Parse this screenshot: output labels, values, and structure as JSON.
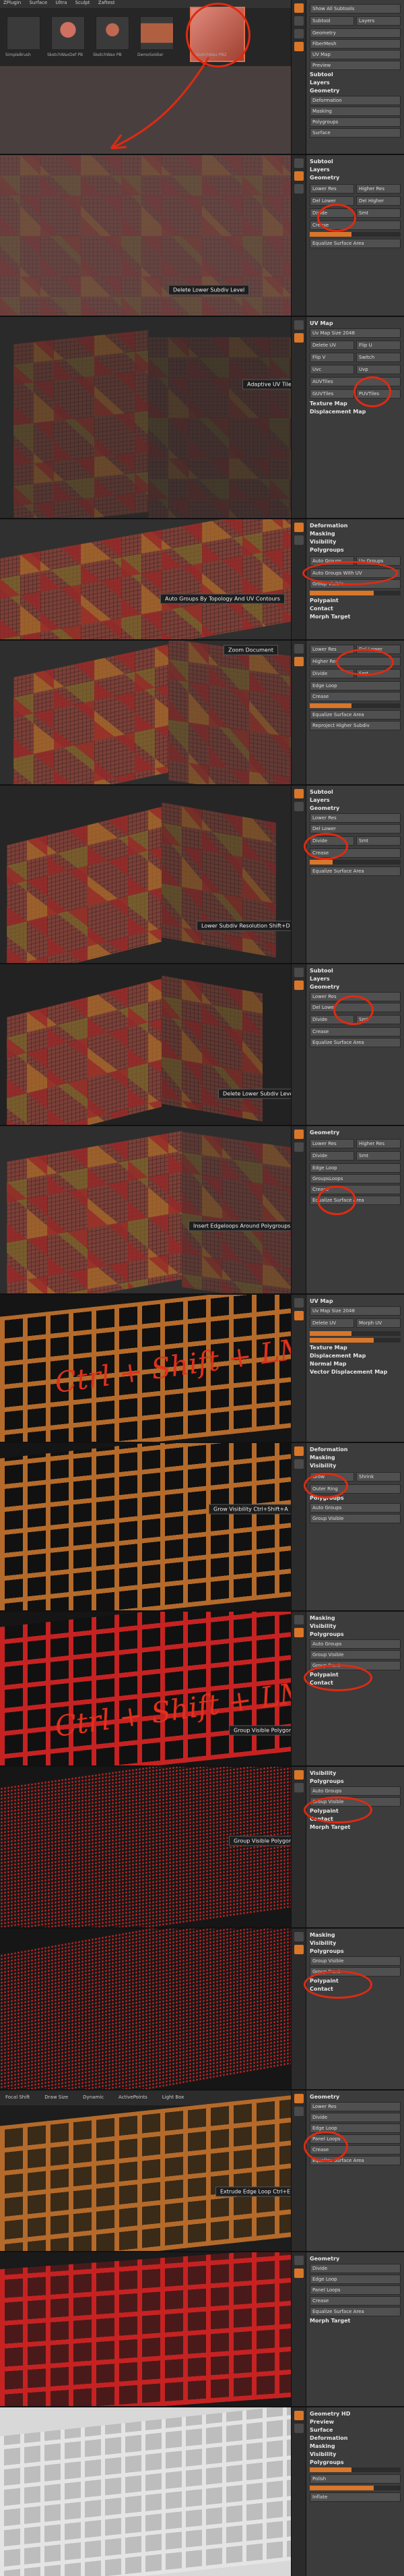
{
  "top": {
    "menu": [
      "ZPlugin",
      "Surface",
      "Ultra",
      "Sculpt",
      "Zaftest"
    ],
    "thumbnails": [
      "SimpleBrush",
      "SketchWaxDef PB",
      "SketchWax PB",
      "DemoSoldier",
      "SketchWax PB2"
    ],
    "side_buttons": [
      "Show All Subtools",
      "Subtool",
      "Layers",
      "Geometry",
      "FiberMesh",
      "UV Map",
      "Preview"
    ]
  },
  "panels": [
    {
      "label": "",
      "sidebar": [
        "Subtool",
        "Layers",
        "Geometry",
        "Deformation",
        "Masking",
        "Polygroups",
        "Surface"
      ]
    },
    {
      "label": "Delete Lower Subdiv Level",
      "sidebar": [
        "Subtool",
        "Layers",
        "Geometry",
        "Lower Res",
        "Higher Res",
        "Del Lower",
        "Del Higher",
        "Divide",
        "Smt",
        "Crease",
        "Equalize Surface Area"
      ]
    },
    {
      "label": "Adaptive UV Tiles",
      "sidebar": [
        "UV Map",
        "Uv Map Size 2048",
        "Delete UV",
        "Flip U",
        "Flip V",
        "Switch",
        "Uvc",
        "Uvp",
        "AUVTiles",
        "GUVTiles",
        "PUVTiles",
        "Texture Map",
        "Displacement Map"
      ]
    },
    {
      "label": "Auto Groups By Topology And UV Contours",
      "sidebar": [
        "Deformation",
        "Masking",
        "Visibility",
        "Polygroups",
        "Auto Groups",
        "Uv Groups",
        "Auto Groups With UV",
        "Group Visible",
        "Polish",
        "Polypaint",
        "Contact",
        "Morph Target"
      ]
    },
    {
      "label": "Zoom Document",
      "sidebar": [
        "Lower Res",
        "Del Lower",
        "Higher Res",
        "Divide",
        "Smt",
        "Edge Loop",
        "Crease",
        "Equalize Surface Area",
        "Reproject Higher Subdiv"
      ]
    },
    {
      "label": "Lower Subdiv Resolution Shift+D",
      "sidebar": [
        "Subtool",
        "Layers",
        "Geometry",
        "Lower Res",
        "Del Lower",
        "Divide",
        "Smt",
        "Crease",
        "Equalize Surface Area"
      ]
    },
    {
      "label": "Delete Lower Subdiv Level",
      "sidebar": [
        "Subtool",
        "Layers",
        "Geometry",
        "Lower Res",
        "Del Lower",
        "Divide",
        "Smt",
        "Crease",
        "Equalize Surface Area"
      ]
    },
    {
      "label": "Insert Edgeloops Around Polygroups",
      "sidebar": [
        "Geometry",
        "Lower Res",
        "Higher Res",
        "Divide",
        "Smt",
        "Edge Loop",
        "GroupsLoops",
        "Crease",
        "Equalize Surface Area"
      ]
    },
    {
      "label": "",
      "scribble": "Ctrl + Shift + LM",
      "sidebar": [
        "UV Map",
        "Uv Map Size 2048",
        "Delete UV",
        "Morph UV",
        "Texture Map",
        "Displacement Map",
        "Normal Map",
        "Vector Displacement Map"
      ]
    },
    {
      "label": "Grow Visibility Ctrl+Shift+A",
      "sidebar": [
        "Deformation",
        "Masking",
        "Visibility",
        "Grow",
        "Shrink",
        "Outer Ring",
        "Polygroups",
        "Auto Groups",
        "Group Visible"
      ]
    },
    {
      "label": "Group Visible Polygons",
      "scribble": "Ctrl + Shift + LM",
      "sidebar": [
        "Masking",
        "Visibility",
        "Polygroups",
        "Auto Groups",
        "Group Visible",
        "Group Front",
        "Polypaint",
        "Contact"
      ]
    },
    {
      "label": "Group Visible Polygons",
      "sidebar": [
        "Visibility",
        "Polygroups",
        "Auto Groups",
        "Group Visible",
        "Polypaint",
        "Contact",
        "Morph Target"
      ]
    },
    {
      "label": "",
      "sidebar": [
        "Masking",
        "Visibility",
        "Polygroups",
        "Group Visible",
        "Group Front",
        "Polypaint",
        "Contact"
      ]
    },
    {
      "label": "Extrude Edge Loop Ctrl+E",
      "toolbar": [
        "Focal Shift",
        "Draw Size",
        "Dynamic",
        "ActivePoints",
        "Light Box"
      ],
      "sidebar": [
        "Geometry",
        "Lower Res",
        "Divide",
        "Edge Loop",
        "Panel Loops",
        "Crease",
        "Equalize Surface Area"
      ]
    },
    {
      "label": "",
      "sidebar": [
        "Geometry",
        "Divide",
        "Edge Loop",
        "Panel Loops",
        "Crease",
        "Equalize Surface Area",
        "Morph Target"
      ]
    },
    {
      "label": "",
      "sidebar": [
        "Geometry HD",
        "Preview",
        "Surface",
        "Deformation",
        "Masking",
        "Visibility",
        "Polygroups",
        "Polish",
        "Inflate"
      ]
    }
  ]
}
